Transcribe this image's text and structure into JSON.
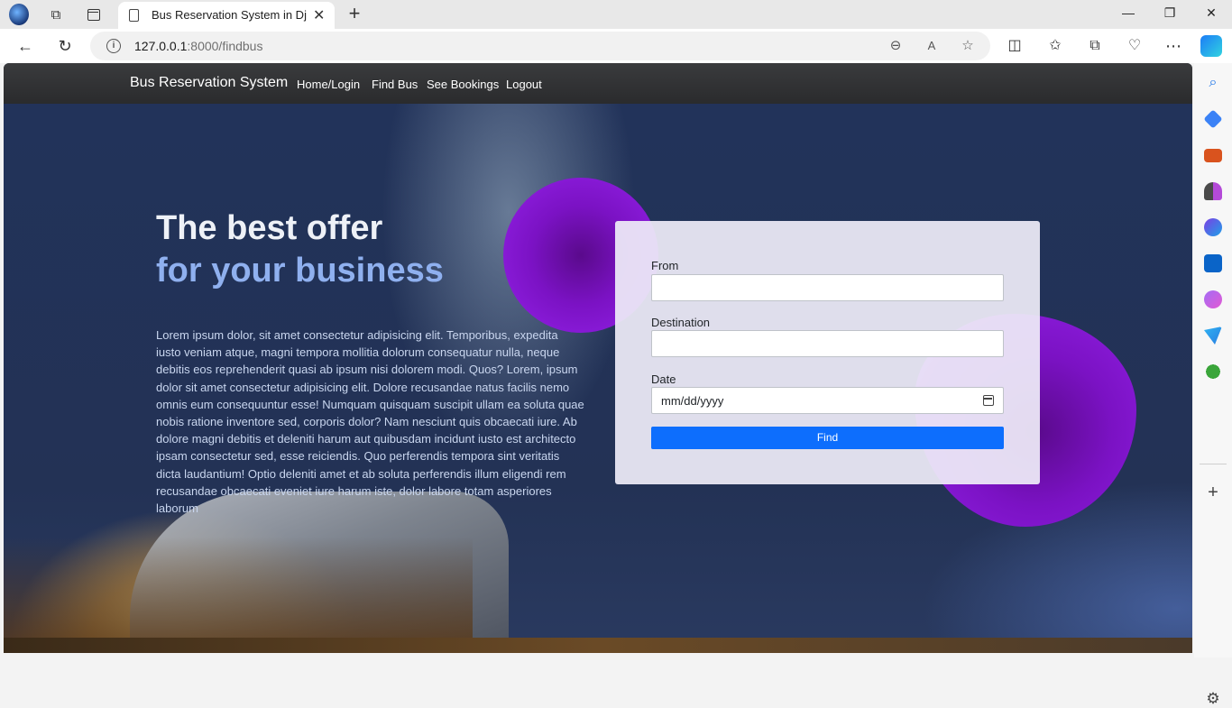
{
  "browser": {
    "tab_title": "Bus Reservation System in Django",
    "url_host": "127.0.0.1",
    "url_rest": ":8000/findbus"
  },
  "navbar": {
    "brand": "Bus Reservation System",
    "links": [
      "Home/Login",
      "Find Bus",
      "See Bookings",
      "Logout"
    ]
  },
  "hero": {
    "heading_line1": "The best offer",
    "heading_line2": "for your business",
    "paragraph": "Lorem ipsum dolor, sit amet consectetur adipisicing elit. Temporibus, expedita iusto veniam atque, magni tempora mollitia dolorum consequatur nulla, neque debitis eos reprehenderit quasi ab ipsum nisi dolorem modi. Quos? Lorem, ipsum dolor sit amet consectetur adipisicing elit. Dolore recusandae natus facilis nemo omnis eum consequuntur esse! Numquam quisquam suscipit ullam ea soluta quae nobis ratione inventore sed, corporis dolor? Nam nesciunt quis obcaecati iure. Ab dolore magni debitis et deleniti harum aut quibusdam incidunt iusto est architecto ipsam consectetur sed, esse reiciendis. Quo perferendis tempora sint veritatis dicta laudantium! Optio deleniti amet et ab soluta perferendis illum eligendi rem recusandae obcaecati eveniet iure harum iste, dolor labore totam asperiores laborum"
  },
  "form": {
    "from_label": "From",
    "from_value": "",
    "destination_label": "Destination",
    "destination_value": "",
    "date_label": "Date",
    "date_placeholder": "mm/dd/yyyy",
    "submit_label": "Find"
  },
  "colors": {
    "accent_button": "#0d6efd",
    "navbar_bg": "#2f3032",
    "blob": "#7b12c4",
    "heading_highlight": "#8fb0ef"
  },
  "icons": {
    "toolbar": [
      "back-icon",
      "refresh-icon",
      "info-icon",
      "zoom-out-icon",
      "read-aloud-icon",
      "favorite-star-icon",
      "split-screen-icon",
      "favorites-icon",
      "collections-icon",
      "browser-essentials-icon",
      "more-icon",
      "copilot-icon"
    ],
    "sidebar": [
      "search-icon",
      "shopping-icon",
      "tools-icon",
      "games-icon",
      "microsoft365-icon",
      "outlook-icon",
      "designer-icon",
      "drop-icon",
      "tree-icon",
      "add-icon",
      "settings-icon"
    ]
  }
}
